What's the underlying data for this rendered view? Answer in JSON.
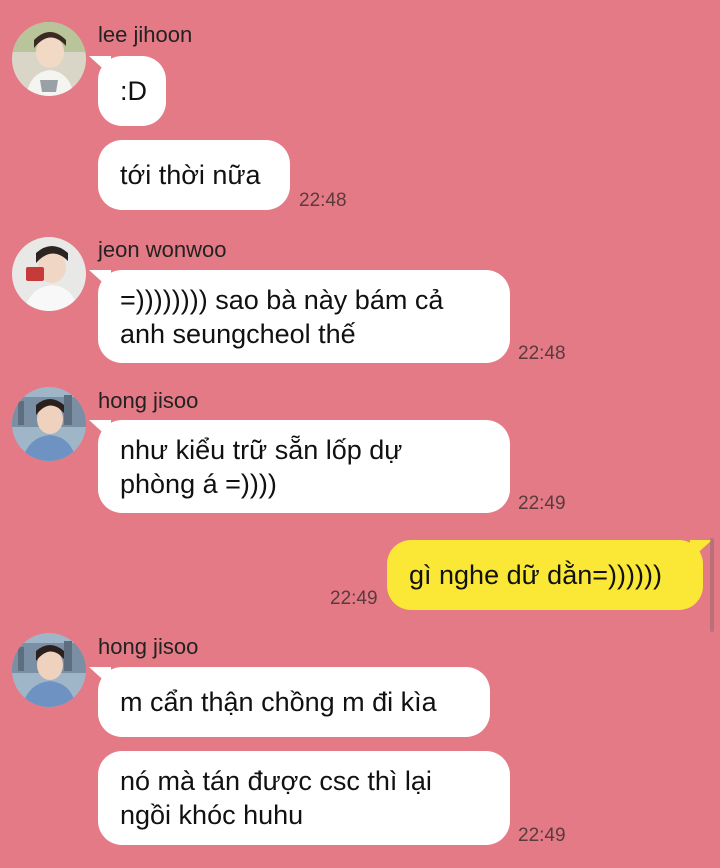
{
  "messages": [
    {
      "sender": "lee jihoon",
      "bubbles": [
        "",
        ":D",
        "tới thời nữa"
      ],
      "time": "22:48"
    },
    {
      "sender": "jeon wonwoo",
      "bubbles": [
        "=)))))))) sao bà này bám cả",
        "anh seungcheol thế"
      ],
      "time": "22:48"
    },
    {
      "sender": "hong jisoo",
      "bubbles": [
        "như kiểu trữ sẵn lốp dự",
        "phòng á =))))"
      ],
      "time": "22:49"
    },
    {
      "sender": "me",
      "bubbles": [
        "gì nghe dữ dằn=))))))"
      ],
      "time": "22:49"
    },
    {
      "sender": "hong jisoo",
      "bubbles": [
        "m cẩn thận chồng m đi kìa",
        "nó mà tán được csc thì lại",
        "ngồi khóc huhu"
      ],
      "time": "22:49"
    }
  ],
  "colors": {
    "background": "#e47a86",
    "incoming_bubble": "#ffffff",
    "outgoing_bubble": "#fbe836"
  }
}
